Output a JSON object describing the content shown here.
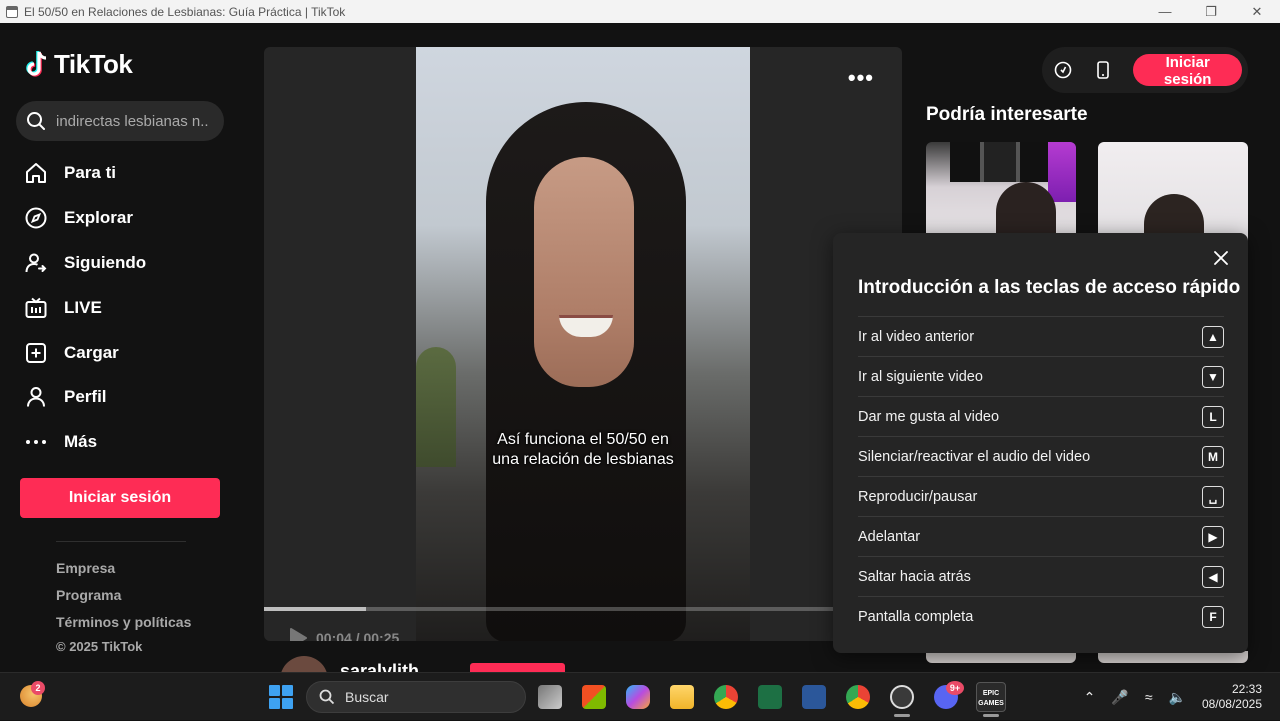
{
  "window": {
    "title": "El 50/50 en Relaciones de Lesbianas: Guía Práctica | TikTok",
    "controls": [
      "minimize-icon",
      "restore-icon",
      "close-icon"
    ]
  },
  "sidebar": {
    "logo_text": "TikTok",
    "search_placeholder": "indirectas lesbianas n...",
    "items": [
      {
        "label": "Para ti",
        "icon": "home-icon"
      },
      {
        "label": "Explorar",
        "icon": "compass-icon"
      },
      {
        "label": "Siguiendo",
        "icon": "following-icon"
      },
      {
        "label": "LIVE",
        "icon": "live-tv-icon"
      },
      {
        "label": "Cargar",
        "icon": "upload-icon"
      },
      {
        "label": "Perfil",
        "icon": "profile-icon"
      },
      {
        "label": "Más",
        "icon": "more-icon"
      }
    ],
    "login_label": "Iniciar sesión",
    "footer_links": [
      "Empresa",
      "Programa",
      "Términos y políticas"
    ],
    "copyright": "© 2025 TikTok"
  },
  "video": {
    "caption_line1": "Así funciona el 50/50 en",
    "caption_line2": "una relación de lesbianas",
    "time_current": "00:04",
    "time_total": "00:25",
    "time_display": "00:04 / 00:25",
    "progress_fraction": 0.16,
    "author": "saralylith"
  },
  "header_right": {
    "login_label": "Iniciar sesión"
  },
  "recommendations": {
    "title": "Podría interesarte"
  },
  "shortcuts_modal": {
    "title": "Introducción a las teclas de acceso rápido",
    "items": [
      {
        "label": "Ir al video anterior",
        "key": "▲"
      },
      {
        "label": "Ir al siguiente video",
        "key": "▼"
      },
      {
        "label": "Dar me gusta al video",
        "key": "L"
      },
      {
        "label": "Silenciar/reactivar el audio del video",
        "key": "M"
      },
      {
        "label": "Reproducir/pausar",
        "key": "␣"
      },
      {
        "label": "Adelantar",
        "key": "▶"
      },
      {
        "label": "Saltar hacia atrás",
        "key": "◀"
      },
      {
        "label": "Pantalla completa",
        "key": "F"
      }
    ]
  },
  "taskbar": {
    "weather_badge": "2",
    "search_label": "Buscar",
    "discord_badge": "9+",
    "epic_label": "EPIC GAMES",
    "time": "22:33",
    "date": "08/08/2025"
  },
  "colors": {
    "accent": "#fe2c55",
    "background": "#121212",
    "modal_bg": "#252525"
  }
}
